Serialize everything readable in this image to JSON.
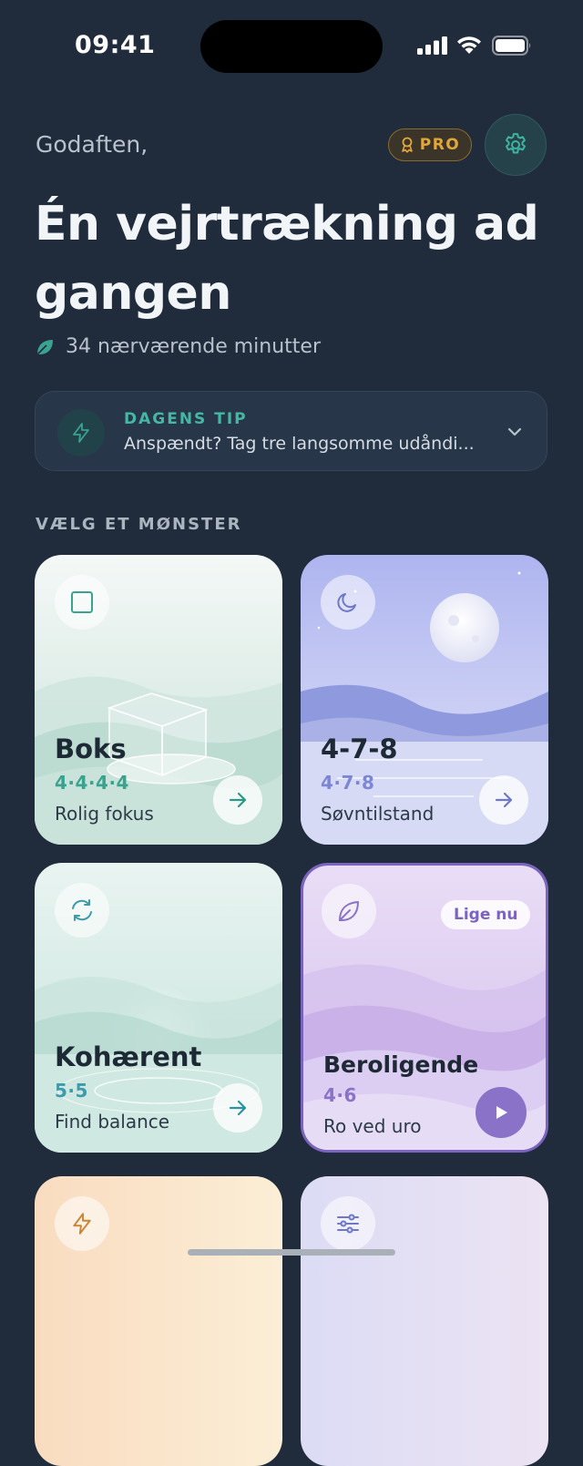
{
  "status_bar": {
    "time": "09:41"
  },
  "header": {
    "greeting": "Godaften,",
    "pro_badge": "PRO",
    "headline": "Én vejrtrækning ad gangen",
    "mindful_minutes": "34 nærværende minutter"
  },
  "tip": {
    "title": "DAGENS TIP",
    "text": "Anspændt? Tag tre langsomme udåndi..."
  },
  "section_label": "VÆLG ET MØNSTER",
  "cards": [
    {
      "title": "Boks",
      "pattern": "4·4·4·4",
      "subtitle": "Rolig fokus",
      "icon": "square-icon",
      "accent": "#3aa38f"
    },
    {
      "title": "4-7-8",
      "pattern": "4·7·8",
      "subtitle": "Søvntilstand",
      "icon": "moon-icon",
      "accent": "#7d86d6"
    },
    {
      "title": "Kohærent",
      "pattern": "5·5",
      "subtitle": "Find balance",
      "icon": "refresh-icon",
      "accent": "#3e9bab"
    },
    {
      "title": "Beroligende",
      "pattern": "4·6",
      "subtitle": "Ro ved uro",
      "icon": "leaf-icon",
      "accent": "#8a72c9",
      "badge": "Lige nu"
    },
    {
      "icon": "lightning-icon"
    },
    {
      "icon": "sliders-icon"
    }
  ],
  "colors": {
    "background": "#202b3c",
    "teal": "#45b8a5",
    "gold": "#e2a63a",
    "purple": "#7b64c0"
  }
}
